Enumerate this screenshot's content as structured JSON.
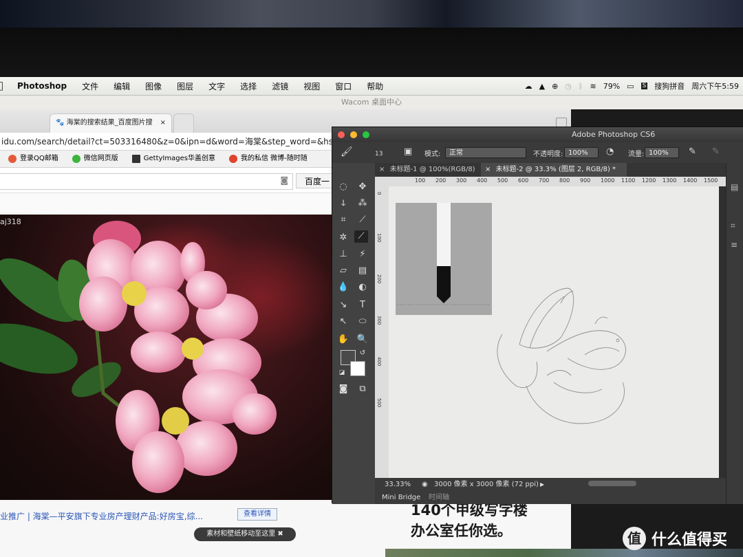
{
  "menubar": {
    "app": "Photoshop",
    "items": [
      "文件",
      "编辑",
      "图像",
      "图层",
      "文字",
      "选择",
      "滤镜",
      "视图",
      "窗口",
      "帮助"
    ],
    "battery": "79%",
    "input_method": "搜狗拼音",
    "clock": "周六下午5:59"
  },
  "wacom_title": "Wacom 桌面中心",
  "browser": {
    "tab_title": "海棠的搜索结果_百度图片搜",
    "tab_close": "×",
    "url": "idu.com/search/detail?ct=503316480&z=0&ipn=d&word=海棠&step_word=&hs=0",
    "bookmarks": [
      "登录QQ邮箱",
      "微信网页版",
      "GettyImages华盖创意",
      "我的私信 微博-随时随"
    ],
    "search_button": "百度一",
    "photo_watermark": "aj318",
    "ad_text": "业推广 | 海棠—平安旗下专业房产理财产品:好房宝,综...",
    "detail_button": "查看详情",
    "toast": "素材和壁纸移动至这里",
    "toast_close": "✖",
    "big_text_line1": "140个甲级写字楼",
    "big_text_line2": "办公室任你选。"
  },
  "photoshop": {
    "window_title": "Adobe Photoshop CS6",
    "brush_size": "13",
    "mode_label": "模式:",
    "mode_value": "正常",
    "opacity_label": "不透明度:",
    "opacity_value": "100%",
    "flow_label": "流量:",
    "flow_value": "100%",
    "doc_tabs": [
      "未标题-1 @ 100%(RGB/8)",
      "未标题-2 @ 33.3% (图层 2, RGB/8) *"
    ],
    "tab_close": "×",
    "ruler_ticks": [
      "100",
      "200",
      "300",
      "400",
      "500",
      "600",
      "700",
      "800",
      "900",
      "1000",
      "1100",
      "1200",
      "1300",
      "1400",
      "1500"
    ],
    "ruler_v_ticks": [
      "0",
      "100",
      "200",
      "300",
      "400",
      "500"
    ],
    "zoom": "33.33%",
    "doc_info": "3000 像素 x 3000 像素 (72 ppi)",
    "bottom_tabs": [
      "Mini Bridge",
      "时间轴"
    ]
  },
  "watermark": {
    "icon": "值",
    "text": "什么值得买"
  },
  "colors": {
    "menubar_bg": "#e9ebe7",
    "ps_dark": "#3c3c3c",
    "canvas": "#ebebea",
    "blossom_pink": "#e98aa8",
    "link_blue": "#2a55b8"
  }
}
